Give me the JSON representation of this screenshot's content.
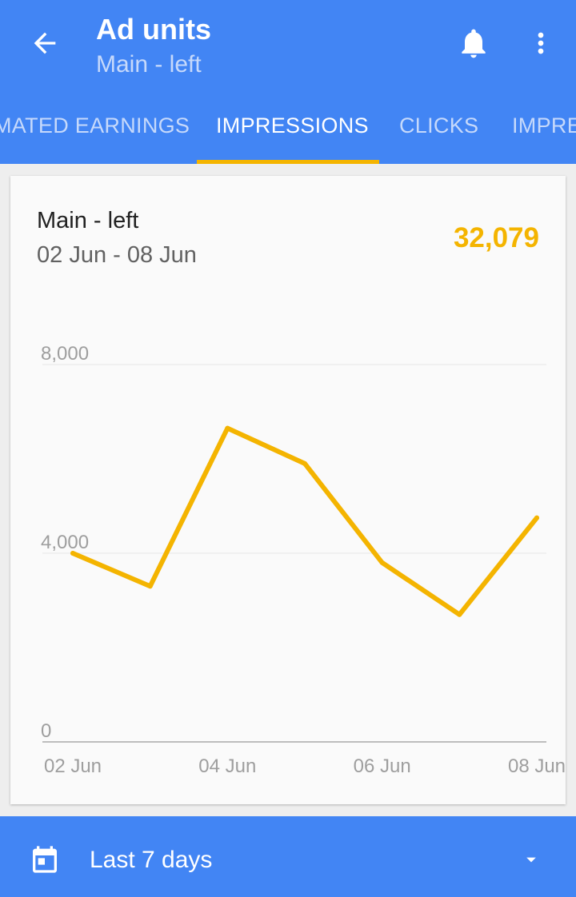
{
  "header": {
    "title": "Ad units",
    "subtitle": "Main - left"
  },
  "tabs": [
    {
      "label": "MATED EARNINGS"
    },
    {
      "label": "IMPRESSIONS"
    },
    {
      "label": "CLICKS"
    },
    {
      "label": "IMPRE"
    }
  ],
  "card": {
    "title": "Main - left",
    "date_range": "02 Jun - 08 Jun",
    "total": "32,079"
  },
  "chart_data": {
    "type": "line",
    "x": [
      "02 Jun",
      "03 Jun",
      "04 Jun",
      "05 Jun",
      "06 Jun",
      "07 Jun",
      "08 Jun"
    ],
    "x_tick_labels": [
      "02 Jun",
      "04 Jun",
      "06 Jun",
      "08 Jun"
    ],
    "y_tick_labels": [
      "8,000",
      "4,000",
      "0"
    ],
    "y_ticks": [
      8000,
      4000,
      0
    ],
    "series": [
      {
        "values": [
          4000,
          3300,
          6650,
          5900,
          3800,
          2700,
          4750
        ]
      }
    ],
    "ylim": [
      0,
      8000
    ],
    "grid": true,
    "line_color": "#f4b400"
  },
  "bottom": {
    "range_label": "Last 7 days"
  },
  "colors": {
    "primary": "#4285f4",
    "accent": "#f4b400"
  },
  "icons": {
    "back": "arrow-back-icon",
    "notifications": "bell-icon",
    "more": "more-vert-icon",
    "calendar": "calendar-icon",
    "dropdown": "dropdown-arrow-icon"
  }
}
